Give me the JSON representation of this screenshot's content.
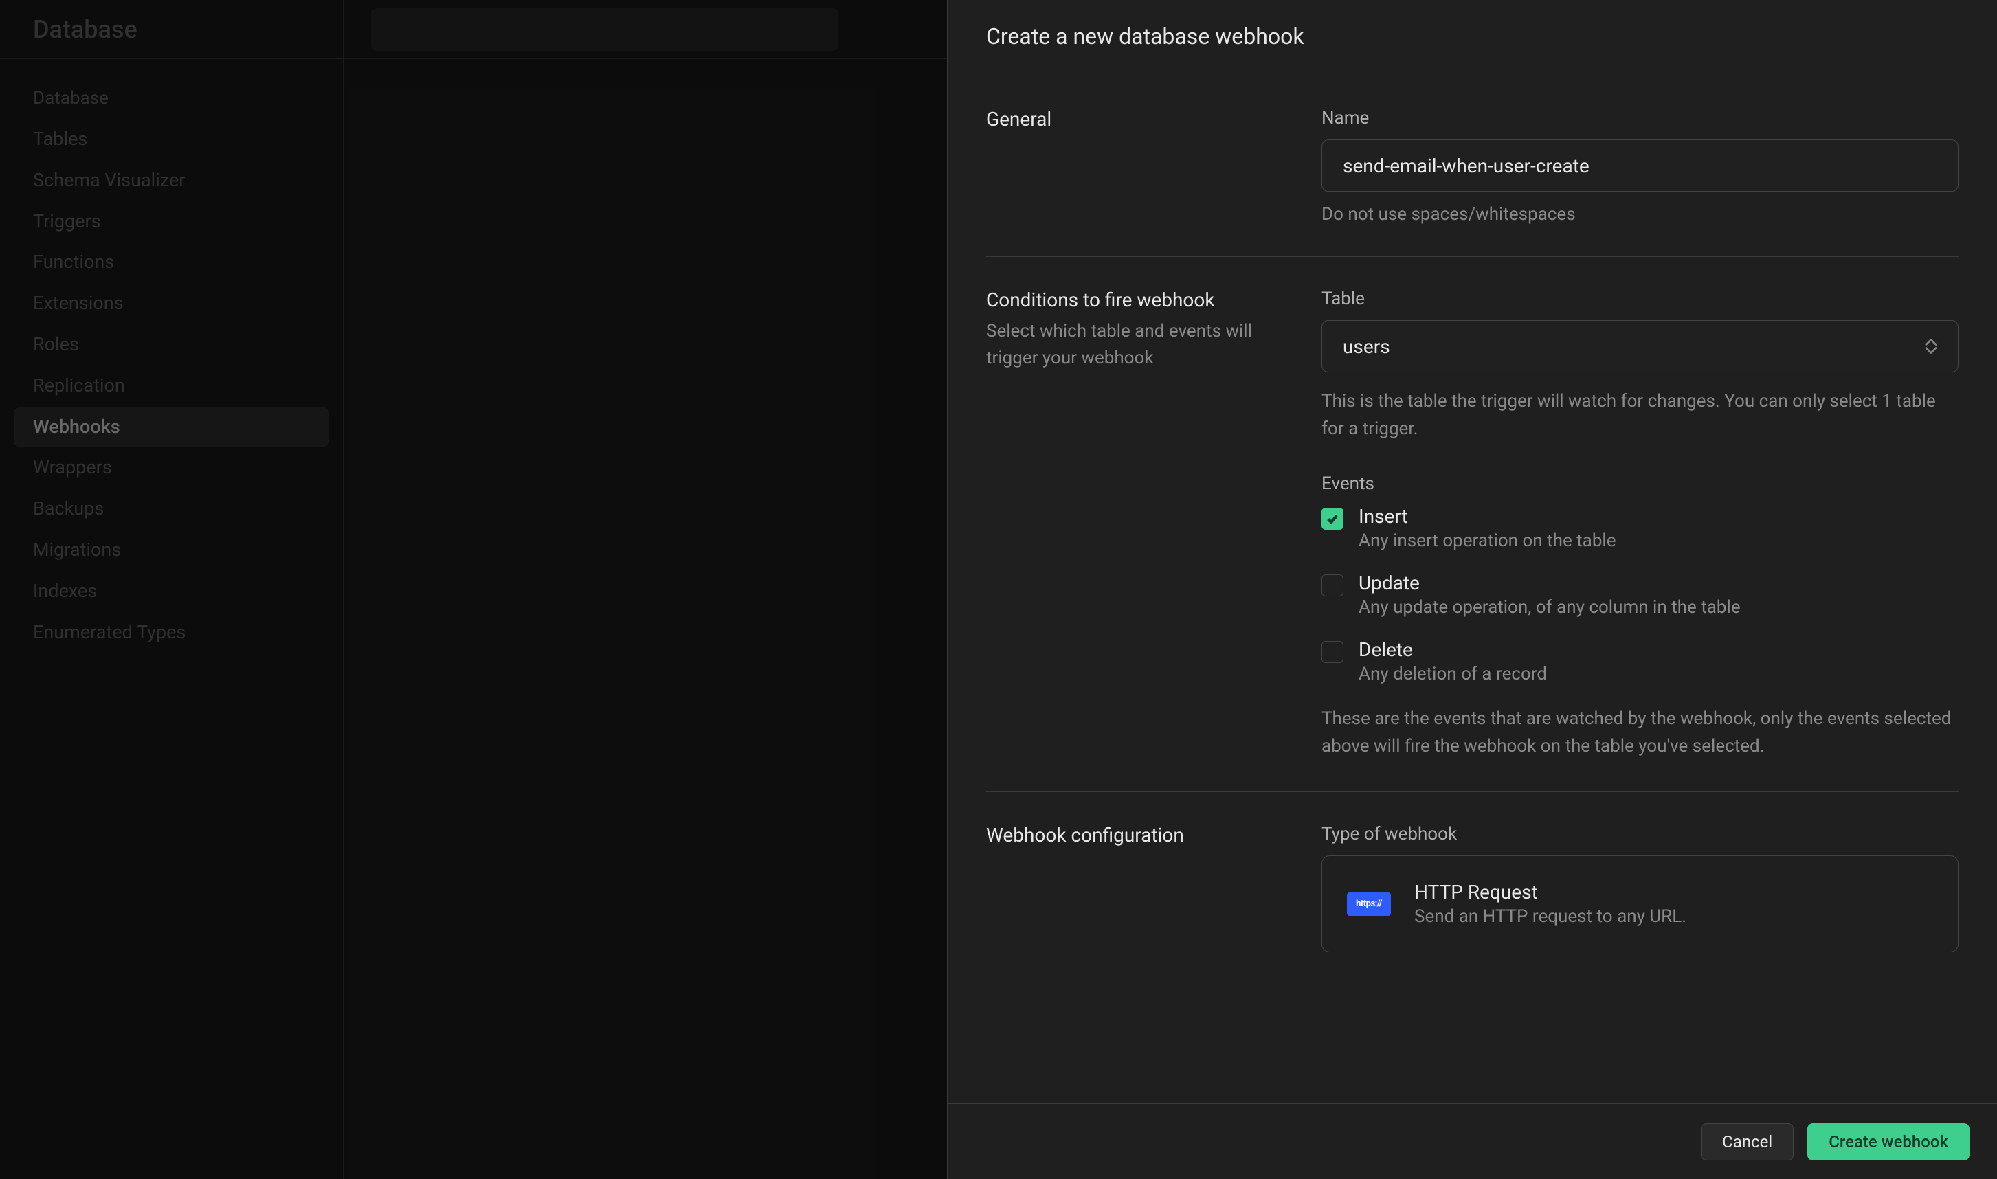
{
  "sidebar": {
    "title": "Database",
    "group_label": "Database",
    "items": [
      {
        "label": "Tables",
        "active": false
      },
      {
        "label": "Schema Visualizer",
        "active": false
      },
      {
        "label": "Triggers",
        "active": false
      },
      {
        "label": "Functions",
        "active": false
      },
      {
        "label": "Extensions",
        "active": false
      },
      {
        "label": "Roles",
        "active": false
      },
      {
        "label": "Replication",
        "active": false
      },
      {
        "label": "Webhooks",
        "active": true
      },
      {
        "label": "Wrappers",
        "active": false
      },
      {
        "label": "Backups",
        "active": false
      },
      {
        "label": "Migrations",
        "active": false
      },
      {
        "label": "Indexes",
        "active": false
      },
      {
        "label": "Enumerated Types",
        "active": false
      }
    ]
  },
  "modal": {
    "title": "Create a new database webhook",
    "sections": {
      "general": {
        "heading": "General",
        "name_label": "Name",
        "name_value": "send-email-when-user-create",
        "name_helper": "Do not use spaces/whitespaces"
      },
      "conditions": {
        "heading": "Conditions to fire webhook",
        "sub": "Select which table and events will trigger your webhook",
        "table_label": "Table",
        "table_value": "users",
        "table_helper": "This is the table the trigger will watch for changes. You can only select 1 table for a trigger.",
        "events_label": "Events",
        "events": [
          {
            "title": "Insert",
            "desc": "Any insert operation on the table",
            "checked": true
          },
          {
            "title": "Update",
            "desc": "Any update operation, of any column in the table",
            "checked": false
          },
          {
            "title": "Delete",
            "desc": "Any deletion of a record",
            "checked": false
          }
        ],
        "events_helper": "These are the events that are watched by the webhook, only the events selected above will fire the webhook on the table you've selected."
      },
      "config": {
        "heading": "Webhook configuration",
        "type_label": "Type of webhook",
        "type_badge": "https://",
        "type_title": "HTTP Request",
        "type_desc": "Send an HTTP request to any URL."
      }
    },
    "footer": {
      "cancel": "Cancel",
      "submit": "Create webhook"
    }
  },
  "colors": {
    "accent": "#3ecf8e",
    "badge": "#2e5cff"
  }
}
